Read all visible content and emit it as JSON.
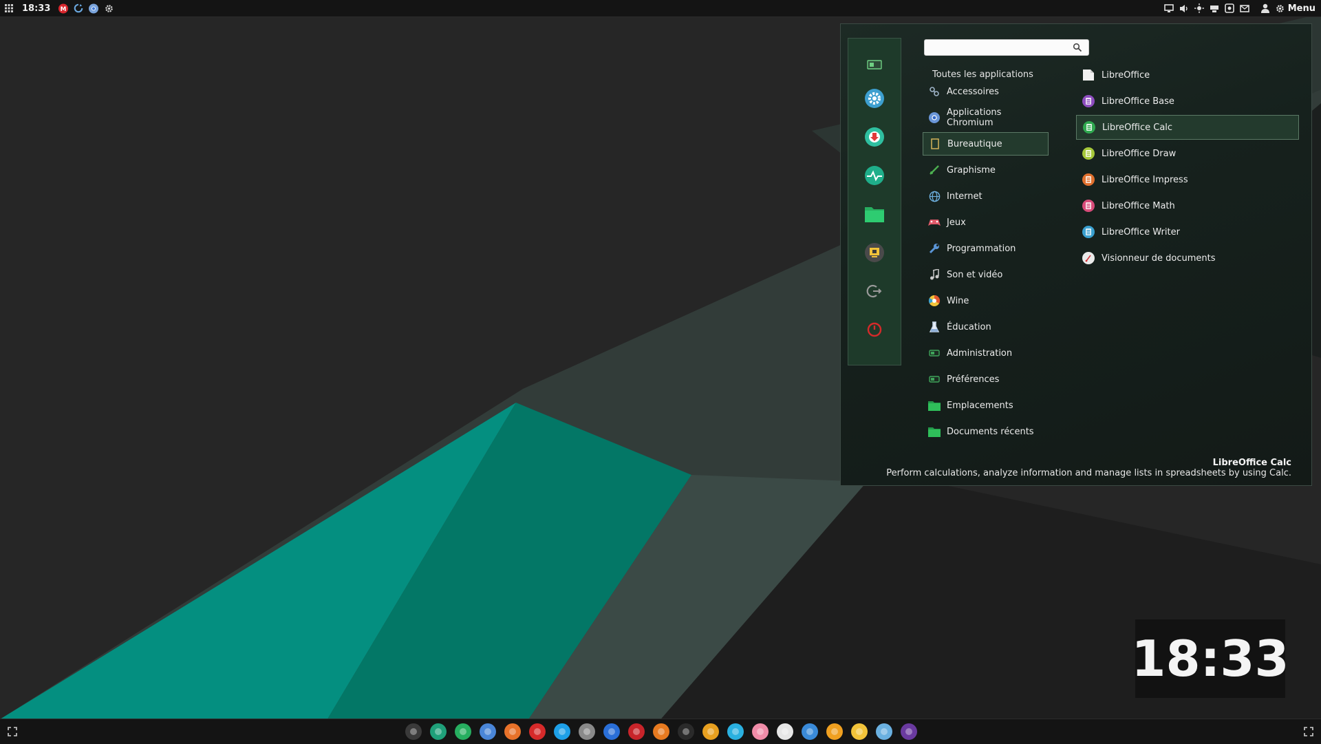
{
  "top_panel": {
    "clock": "18:33",
    "menu_label": "Menu",
    "left_icons": [
      "apps-grid-icon",
      "mega-icon",
      "sync-icon",
      "chromium-icon",
      "settings-icon"
    ],
    "tray_icons": [
      "display-icon",
      "volume-icon",
      "brightness-icon",
      "removable-drive-icon",
      "screenshot-icon",
      "messaging-icon",
      "user-icon"
    ]
  },
  "menu": {
    "search": {
      "value": "",
      "placeholder": ""
    },
    "all_applications": "Toutes les applications",
    "sidebar": [
      "terminal-icon",
      "system-settings-icon",
      "software-manager-icon",
      "system-monitor-icon",
      "files-icon",
      "screen-lock-icon",
      "logout-icon",
      "power-icon"
    ],
    "categories": [
      {
        "label": "Accessoires",
        "icon": "accessories-icon",
        "color": "#9fb4c8"
      },
      {
        "label": "Applications Chromium",
        "icon": "chromium-icon",
        "color": "#6a96d8"
      },
      {
        "label": "Bureautique",
        "icon": "office-icon",
        "color": "#d6b35a",
        "selected": true
      },
      {
        "label": "Graphisme",
        "icon": "graphics-icon",
        "color": "#4caf50"
      },
      {
        "label": "Internet",
        "icon": "internet-icon",
        "color": "#6fb1e0"
      },
      {
        "label": "Jeux",
        "icon": "games-icon",
        "color": "#e05a6a"
      },
      {
        "label": "Programmation",
        "icon": "programming-icon",
        "color": "#5a95d6"
      },
      {
        "label": "Son et vidéo",
        "icon": "multimedia-icon",
        "color": "#c9c9c9"
      },
      {
        "label": "Wine",
        "icon": "wine-icon",
        "color": "#e4572e"
      },
      {
        "label": "Éducation",
        "icon": "education-icon",
        "color": "#c8d8ea"
      },
      {
        "label": "Administration",
        "icon": "administration-icon",
        "color": "#3ea35a"
      },
      {
        "label": "Préférences",
        "icon": "preferences-icon",
        "color": "#3ea35a"
      },
      {
        "label": "Emplacements",
        "icon": "places-folder-icon",
        "color": "#2fbf5a"
      },
      {
        "label": "Documents récents",
        "icon": "recent-folder-icon",
        "color": "#2fbf5a"
      }
    ],
    "apps": [
      {
        "label": "LibreOffice",
        "icon": "libreoffice-icon",
        "color": "#f2f2f2"
      },
      {
        "label": "LibreOffice Base",
        "icon": "libreoffice-base-icon",
        "color": "#8e4dbf"
      },
      {
        "label": "LibreOffice Calc",
        "icon": "libreoffice-calc-icon",
        "color": "#2fa84f",
        "selected": true
      },
      {
        "label": "LibreOffice Draw",
        "icon": "libreoffice-draw-icon",
        "color": "#a6c83a"
      },
      {
        "label": "LibreOffice Impress",
        "icon": "libreoffice-impress-icon",
        "color": "#e0702e"
      },
      {
        "label": "LibreOffice Math",
        "icon": "libreoffice-math-icon",
        "color": "#d84c7a"
      },
      {
        "label": "LibreOffice Writer",
        "icon": "libreoffice-writer-icon",
        "color": "#3aa0d0"
      },
      {
        "label": "Visionneur de documents",
        "icon": "document-viewer-icon",
        "color": "#eaeaea"
      }
    ],
    "description": {
      "title": "LibreOffice Calc",
      "text": "Perform calculations, analyze information and manage lists in spreadsheets by using Calc."
    }
  },
  "desklet_clock": "18:33",
  "dock": [
    {
      "icon": "terminal-icon",
      "color": "#3a3a3a"
    },
    {
      "icon": "system-monitor-icon",
      "color": "#1fa07a"
    },
    {
      "icon": "files-icon",
      "color": "#27ae60"
    },
    {
      "icon": "chromium-icon",
      "color": "#4a86d8"
    },
    {
      "icon": "firefox-icon",
      "color": "#e8722a"
    },
    {
      "icon": "opera-icon",
      "color": "#d62a2a"
    },
    {
      "icon": "skype-icon",
      "color": "#1ea0e8"
    },
    {
      "icon": "inkscape-icon",
      "color": "#8a8a8a"
    },
    {
      "icon": "dropbox-icon",
      "color": "#2a6fd8"
    },
    {
      "icon": "filezilla-icon",
      "color": "#c8242a"
    },
    {
      "icon": "blender-icon",
      "color": "#e77a20"
    },
    {
      "icon": "steam-icon",
      "color": "#2a2a2a"
    },
    {
      "icon": "picasa-icon",
      "color": "#e8a020"
    },
    {
      "icon": "screenshot-tool-icon",
      "color": "#2ab0e0"
    },
    {
      "icon": "pink-app-icon",
      "color": "#f08ca8"
    },
    {
      "icon": "vlc-like-icon",
      "color": "#e6e6e6"
    },
    {
      "icon": "intellij-icon",
      "color": "#3a8ad8"
    },
    {
      "icon": "drawing-app-icon",
      "color": "#f0a020"
    },
    {
      "icon": "image-viewer-icon",
      "color": "#f2c33a"
    },
    {
      "icon": "update-icon",
      "color": "#6ab0e0"
    },
    {
      "icon": "game-character-icon",
      "color": "#6a3aa0"
    }
  ]
}
